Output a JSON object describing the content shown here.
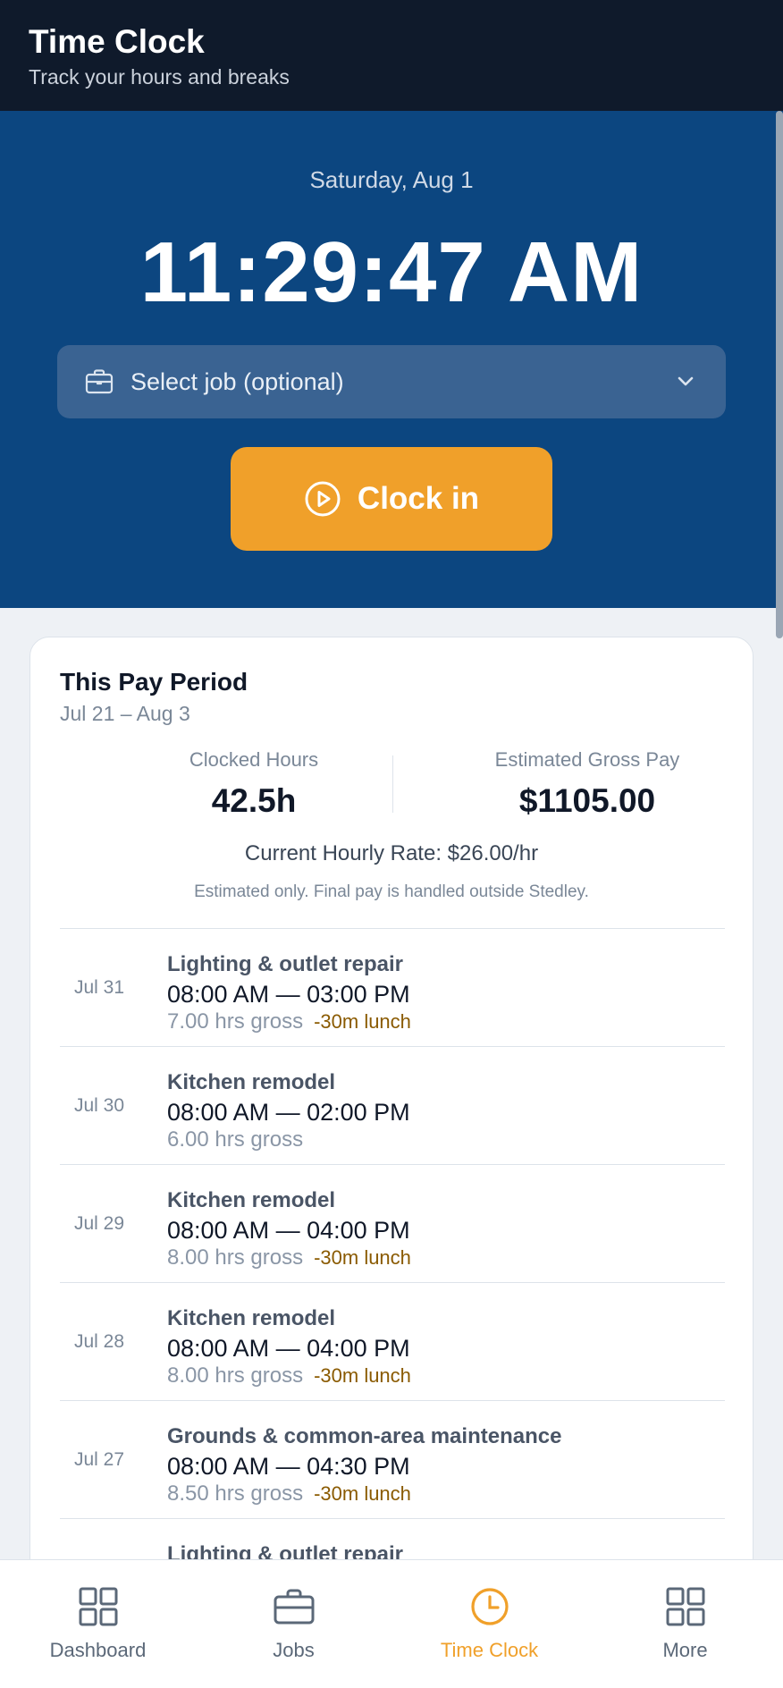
{
  "header": {
    "title": "Time Clock",
    "subtitle": "Track your hours and breaks"
  },
  "clock": {
    "date": "Saturday, Aug 1",
    "time": "11:29:47 AM",
    "job_select_placeholder": "Select job (optional)",
    "clock_in_label": "Clock in"
  },
  "pay_period": {
    "title": "This Pay Period",
    "range": "Jul 21 – Aug 3",
    "hours_label": "Clocked Hours",
    "hours_value": "42.5h",
    "pay_label": "Estimated Gross Pay",
    "pay_value": "$1105.00",
    "rate": "Current Hourly Rate: $26.00/hr",
    "disclaimer": "Estimated only. Final pay is handled outside Stedley."
  },
  "entries": [
    {
      "date": "Jul 31",
      "job": "Lighting & outlet repair",
      "time": "08:00 AM — 03:00 PM",
      "gross": "7.00 hrs gross",
      "lunch": "-30m lunch"
    },
    {
      "date": "Jul 30",
      "job": "Kitchen remodel",
      "time": "08:00 AM — 02:00 PM",
      "gross": "6.00 hrs gross",
      "lunch": ""
    },
    {
      "date": "Jul 29",
      "job": "Kitchen remodel",
      "time": "08:00 AM — 04:00 PM",
      "gross": "8.00 hrs gross",
      "lunch": "-30m lunch"
    },
    {
      "date": "Jul 28",
      "job": "Kitchen remodel",
      "time": "08:00 AM — 04:00 PM",
      "gross": "8.00 hrs gross",
      "lunch": "-30m lunch"
    },
    {
      "date": "Jul 27",
      "job": "Grounds & common-area maintenance",
      "time": "08:00 AM — 04:30 PM",
      "gross": "8.50 hrs gross",
      "lunch": "-30m lunch"
    },
    {
      "date": "",
      "job": "Lighting & outlet repair",
      "time": "",
      "gross": "",
      "lunch": ""
    }
  ],
  "nav": {
    "items": [
      {
        "label": "Dashboard",
        "icon": "grid-icon"
      },
      {
        "label": "Jobs",
        "icon": "briefcase-icon"
      },
      {
        "label": "Time Clock",
        "icon": "clock-icon",
        "active": true
      },
      {
        "label": "More",
        "icon": "grid-icon"
      }
    ]
  },
  "colors": {
    "header_bg": "#0f1a2b",
    "hero_bg": "#0c4680",
    "accent": "#f0a02a",
    "lunch": "#8a5a00"
  }
}
